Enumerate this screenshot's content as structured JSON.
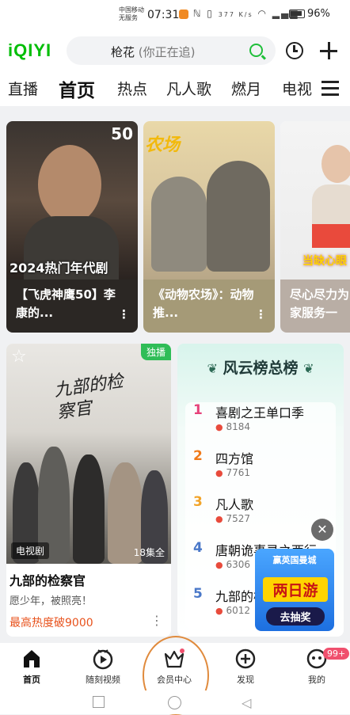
{
  "status_bar": {
    "carrier_line1": "中国移动",
    "carrier_line2": "无服务",
    "time": "07:31",
    "net_speed": "377 K/s",
    "battery": "96%"
  },
  "header": {
    "logo": "iQIYI",
    "search_keyword": "枪花",
    "search_hint": "(你正在追)"
  },
  "tabs": [
    {
      "label": "直播"
    },
    {
      "label": "首页"
    },
    {
      "label": "热点"
    },
    {
      "label": "凡人歌"
    },
    {
      "label": "燃月"
    },
    {
      "label": "电视"
    }
  ],
  "cards": [
    {
      "overlay_num": "50",
      "image_text": "2024热门年代剧",
      "caption": "【飞虎神鹰50】李康的..."
    },
    {
      "image_text": "农场",
      "caption": "《动物农场》：动物推..."
    },
    {
      "image_text": "当缺心眼",
      "caption": "尽心尽力为家服务一"
    }
  ],
  "drama": {
    "badge_exclusive": "独播",
    "poster_title": "九部的检察官",
    "tv_label": "电视剧",
    "episodes": "18集全",
    "title": "九部的检察官",
    "subtitle": "愿少年，被照亮！",
    "heat": "最高热度破9000"
  },
  "ranking": {
    "title": "风云榜总榜",
    "items": [
      {
        "rank": "1",
        "name": "喜剧之王单口季",
        "heat": "8184"
      },
      {
        "rank": "2",
        "name": "四方馆",
        "heat": "7761"
      },
      {
        "rank": "3",
        "name": "凡人歌",
        "heat": "7527"
      },
      {
        "rank": "4",
        "name": "唐朝诡事录之西行",
        "heat": "6306"
      },
      {
        "rank": "5",
        "name": "九部的检察官",
        "heat": "6012"
      }
    ]
  },
  "promo": {
    "line1": "赢英国曼城",
    "line2": "两日游",
    "button": "去抽奖"
  },
  "bottom_nav": [
    {
      "label": "首页"
    },
    {
      "label": "随刻视频"
    },
    {
      "label": "会员中心"
    },
    {
      "label": "发现"
    },
    {
      "label": "我的"
    }
  ],
  "notification_badge": "99+",
  "colors": {
    "brand_green": "#00be06",
    "accent_orange": "#e8521c",
    "rank1": "#e6427a",
    "rank2": "#f07a1a",
    "rank3": "#f2a42a",
    "rank45": "#4a78c8"
  }
}
